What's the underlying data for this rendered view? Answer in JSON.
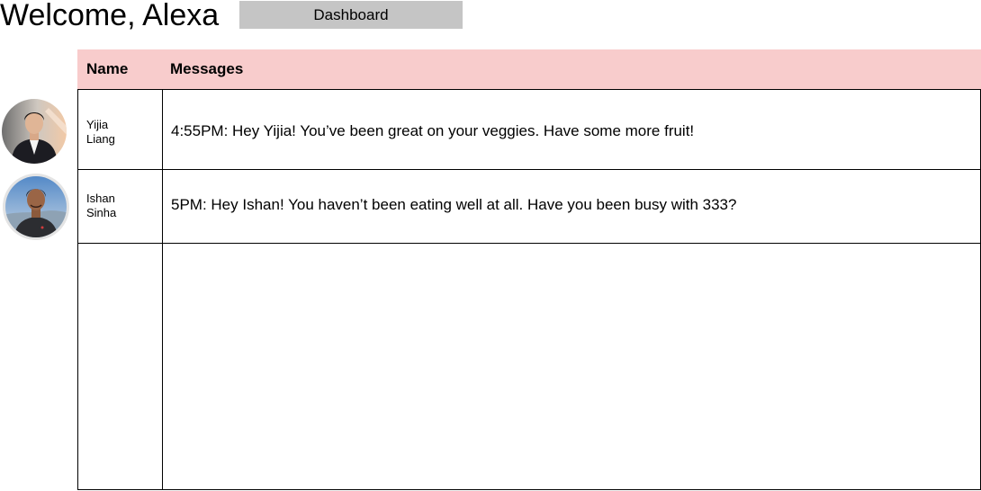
{
  "header": {
    "welcome": "Welcome, Alexa",
    "dashboard_label": "Dashboard"
  },
  "table": {
    "columns": [
      "Name",
      "Messages"
    ],
    "rows": [
      {
        "first_name": "Yijia",
        "last_name": "Liang",
        "message": "4:55PM: Hey Yijia! You’ve been great on your veggies. Have some more fruit!"
      },
      {
        "first_name": "Ishan",
        "last_name": "Sinha",
        "message": "5PM: Hey Ishan! You haven’t been eating well at all. Have you been busy with 333?"
      }
    ]
  },
  "colors": {
    "header_bg": "#f8cccc",
    "dashboard_bg": "#c5c5c5"
  }
}
